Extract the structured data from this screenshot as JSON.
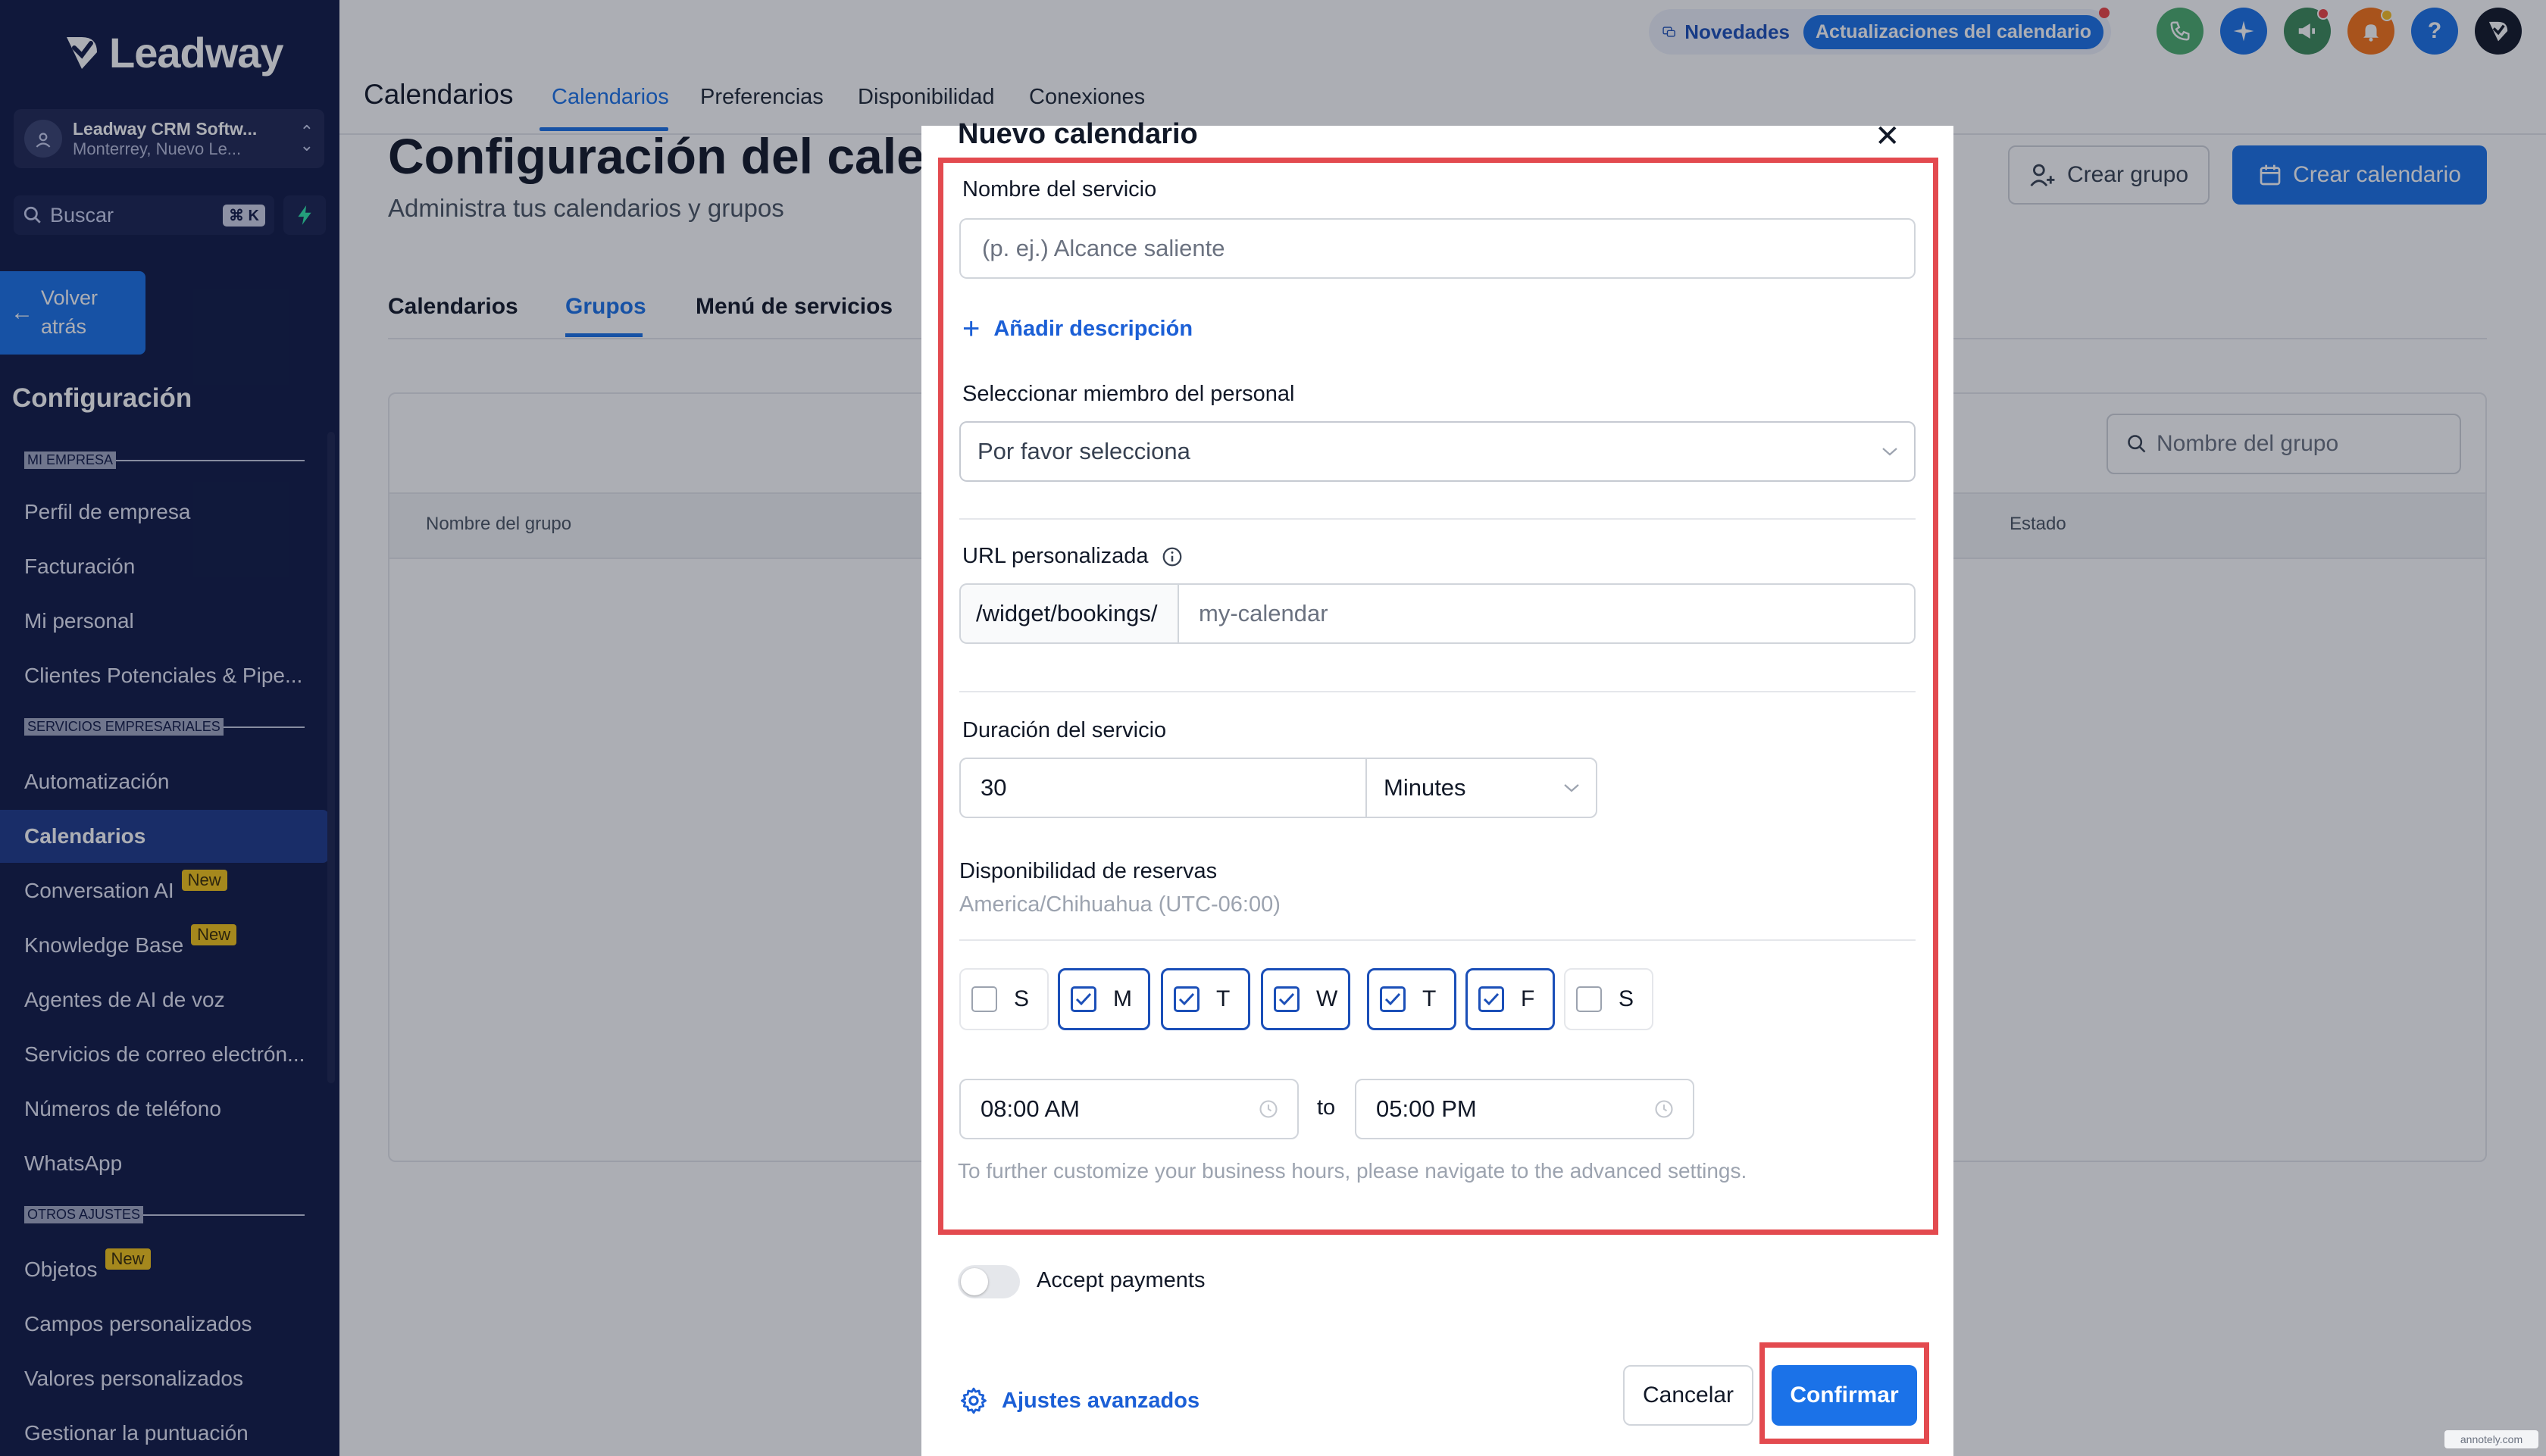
{
  "sidebar": {
    "logo_text": "Leadway",
    "account": {
      "name": "Leadway CRM Softw...",
      "location": "Monterrey, Nuevo Le..."
    },
    "search": {
      "label": "Buscar",
      "shortcut": "⌘ K"
    },
    "back_label_1": "Volver",
    "back_label_2": "atrás",
    "section_title": "Configuración",
    "sections": {
      "mi_empresa": "MI EMPRESA",
      "servicios": "SERVICIOS EMPRESARIALES",
      "otros": "OTROS AJUSTES"
    },
    "items": {
      "perfil": "Perfil de empresa",
      "facturacion": "Facturación",
      "mi_personal": "Mi personal",
      "clientes": "Clientes Potenciales & Pipe...",
      "automatizacion": "Automatización",
      "calendarios": "Calendarios",
      "conversation_ai": "Conversation AI",
      "knowledge_base": "Knowledge Base",
      "agentes_ai": "Agentes de AI de voz",
      "correo": "Servicios de correo electrón...",
      "telefono": "Números de teléfono",
      "whatsapp": "WhatsApp",
      "objetos": "Objetos",
      "campos": "Campos personalizados",
      "valores": "Valores personalizados",
      "puntuacion": "Gestionar la puntuación"
    },
    "badge_new": "New"
  },
  "topbar": {
    "heading": "Calendarios",
    "tabs": {
      "calendarios": "Calendarios",
      "preferencias": "Preferencias",
      "disponibilidad": "Disponibilidad",
      "conexiones": "Conexiones"
    },
    "novedades": "Novedades",
    "updates_chip": "Actualizaciones del calendario",
    "help_icon_text": "?"
  },
  "main": {
    "title": "Configuración del calendario",
    "subtitle": "Administra tus calendarios y grupos",
    "subtabs": {
      "calendarios": "Calendarios",
      "grupos": "Grupos",
      "menu": "Menú de servicios"
    },
    "btn_crear_grupo": "Crear grupo",
    "btn_crear_calendario": "Crear calendario",
    "groups_search_placeholder": "Nombre del grupo",
    "table_headers": {
      "name": "Nombre del grupo",
      "status": "Estado"
    }
  },
  "modal": {
    "title": "Nuevo calendario",
    "service_name_label": "Nombre del servicio",
    "service_name_placeholder": "(p. ej.) Alcance saliente",
    "add_description": "Añadir descripción",
    "staff_label": "Seleccionar miembro del personal",
    "staff_placeholder": "Por favor selecciona",
    "url_label": "URL personalizada",
    "url_prefix": "/widget/bookings/",
    "url_placeholder": "my-calendar",
    "duration_label": "Duración del servicio",
    "duration_value": "30",
    "duration_unit": "Minutes",
    "availability_label": "Disponibilidad de reservas",
    "timezone": "America/Chihuahua (UTC-06:00)",
    "days": [
      {
        "letter": "S",
        "checked": false
      },
      {
        "letter": "M",
        "checked": true
      },
      {
        "letter": "T",
        "checked": true
      },
      {
        "letter": "W",
        "checked": true
      },
      {
        "letter": "T",
        "checked": true
      },
      {
        "letter": "F",
        "checked": true
      },
      {
        "letter": "S",
        "checked": false
      }
    ],
    "start_time": "08:00 AM",
    "to_label": "to",
    "end_time": "05:00 PM",
    "help_text": "To further customize your business hours, please navigate to the advanced settings.",
    "accept_payments": "Accept payments",
    "advanced_settings": "Ajustes avanzados",
    "cancel": "Cancelar",
    "confirm": "Confirmar"
  },
  "watermark": "annotely.com",
  "colors": {
    "sidebar_bg": "#101a46",
    "accent": "#1b72e8",
    "highlight_red": "#e34a4f"
  }
}
